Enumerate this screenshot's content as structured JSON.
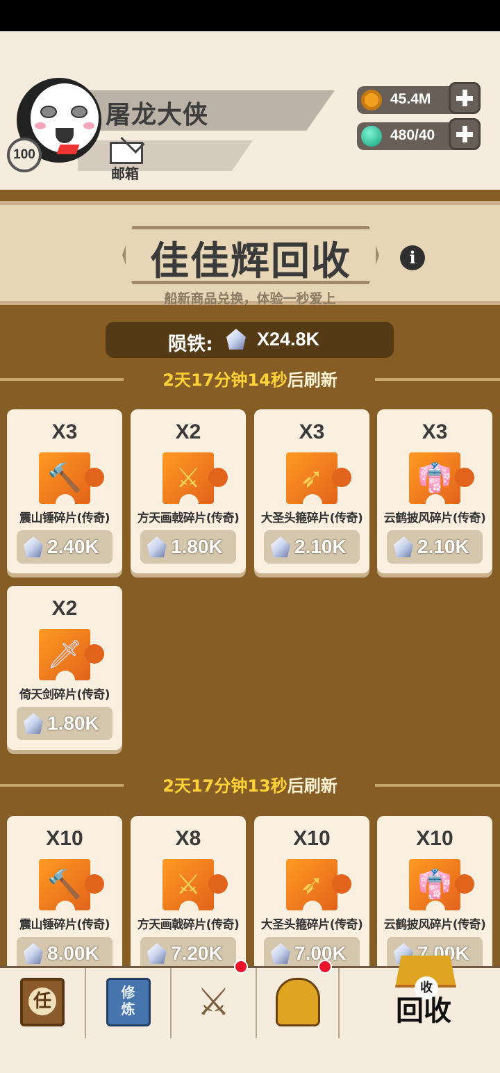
{
  "player": {
    "name": "屠龙大侠",
    "level": "100",
    "mail_label": "邮箱"
  },
  "resources": {
    "gold": "45.4M",
    "energy": "480/40"
  },
  "shop": {
    "title": "佳佳辉回收",
    "subtitle": "船新商品兑换，体验一秒爱上",
    "currency_label": "陨铁:",
    "currency_value": "X24.8K"
  },
  "section1": {
    "refresh_time": "2天17分钟14秒",
    "refresh_suffix": "后刷新",
    "items": [
      {
        "qty": "X3",
        "name": "震山锤碎片(传奇)",
        "price": "2.40K",
        "icon": "hammer-icon"
      },
      {
        "qty": "X2",
        "name": "方天画戟碎片(传奇)",
        "price": "1.80K",
        "icon": "halberd-icon"
      },
      {
        "qty": "X3",
        "name": "大圣头箍碎片(传奇)",
        "price": "2.10K",
        "icon": "staff-icon"
      },
      {
        "qty": "X3",
        "name": "云鹤披风碎片(传奇)",
        "price": "2.10K",
        "icon": "cloak-icon"
      },
      {
        "qty": "X2",
        "name": "倚天剑碎片(传奇)",
        "price": "1.80K",
        "icon": "sword-icon"
      }
    ]
  },
  "section2": {
    "refresh_time": "2天17分钟13秒",
    "refresh_suffix": "后刷新",
    "items": [
      {
        "qty": "X10",
        "name": "震山锤碎片(传奇)",
        "price": "8.00K",
        "icon": "hammer-icon"
      },
      {
        "qty": "X8",
        "name": "方天画戟碎片(传奇)",
        "price": "7.20K",
        "icon": "halberd-icon"
      },
      {
        "qty": "X10",
        "name": "大圣头箍碎片(传奇)",
        "price": "7.00K",
        "icon": "staff-icon"
      },
      {
        "qty": "X10",
        "name": "云鹤披风碎片(传奇)",
        "price": "7.00K",
        "icon": "cloak-icon"
      }
    ]
  },
  "nav": {
    "task": "任",
    "cultivate": "修炼",
    "recycle_badge": "收",
    "recycle_label": "回收"
  },
  "colors": {
    "main_bg": "#865e25",
    "refresh_yellow": "#ffd23a",
    "piece_orange": "#f0781e",
    "badge_red": "#e8132a"
  }
}
